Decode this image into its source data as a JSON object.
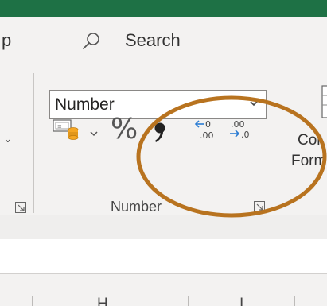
{
  "tell_me": {
    "help_fragment": "p",
    "search_label": "Search"
  },
  "number_group": {
    "format_value": "Number",
    "group_label": "Number",
    "percent_symbol": "%"
  },
  "next_group": {
    "label_line1": "Cor",
    "label_line2": "Form"
  },
  "columns": [
    "H",
    "I"
  ],
  "colors": {
    "title_bar": "#1e7145",
    "ribbon_bg": "#f3f2f1",
    "decimal_icon_blue": "#2b7cd3",
    "highlight_ellipse": "#b8731f"
  },
  "icons": [
    "search-icon",
    "number-format-dropdown-icon",
    "accounting-format-icon",
    "percent-style-icon",
    "comma-style-icon",
    "increase-decimal-icon",
    "decrease-decimal-icon",
    "dialog-launcher-icon"
  ]
}
